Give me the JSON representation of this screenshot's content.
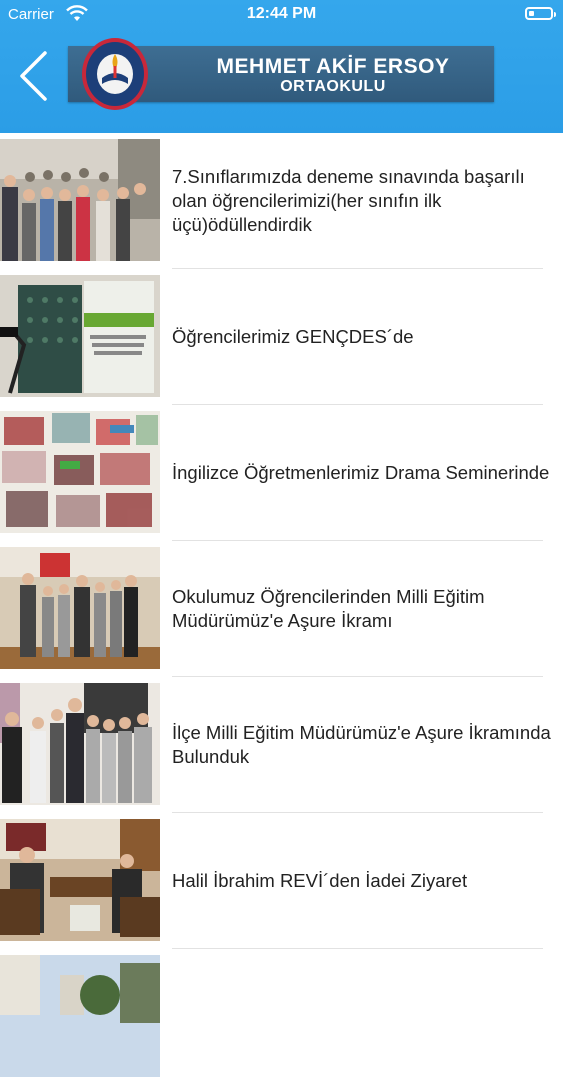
{
  "status_bar": {
    "carrier": "Carrier",
    "time": "12:44 PM"
  },
  "header": {
    "title_line1": "MEHMET AKİF ERSOY",
    "title_line2": "ORTAOKULU",
    "back_icon": "chevron-left-icon",
    "logo_icon": "school-seal-icon",
    "colors": {
      "header_bg": "#2b9de6",
      "banner_bg": "#305a7c"
    }
  },
  "news": [
    {
      "title": "7.Sınıflarımızda deneme sınavında başarılı olan öğrencilerimizi(her sınıfın ilk üçü)ödüllendirdik"
    },
    {
      "title": "Öğrencilerimiz GENÇDES´de"
    },
    {
      "title": "İngilizce Öğretmenlerimiz Drama Seminerinde"
    },
    {
      "title": "Okulumuz Öğrencilerinden Milli Eğitim Müdürümüz'e Aşure İkramı"
    },
    {
      "title": "İlçe Milli Eğitim Müdürümüz'e Aşure İkramında Bulunduk"
    },
    {
      "title": "Halil İbrahim REVİ´den İadei Ziyaret"
    },
    {
      "title": ""
    }
  ]
}
